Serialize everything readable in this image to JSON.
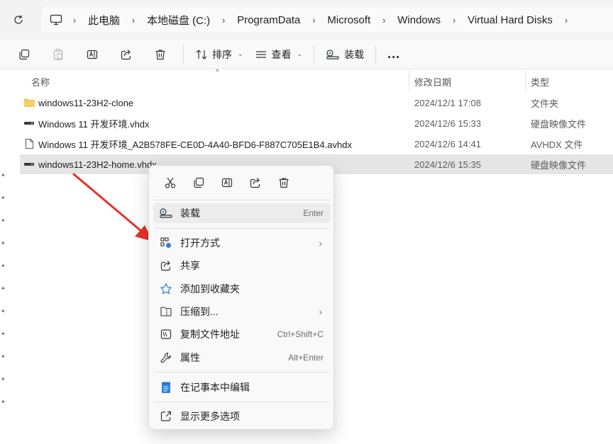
{
  "address_bar": {
    "refresh_icon": "refresh-icon",
    "pc_icon": "computer-icon",
    "crumbs": [
      "此电脑",
      "本地磁盘 (C:)",
      "ProgramData",
      "Microsoft",
      "Windows",
      "Virtual Hard Disks"
    ]
  },
  "toolbar": {
    "sort_label": "排序",
    "view_label": "查看",
    "mount_label": "装载",
    "more_label": "..."
  },
  "columns": {
    "name": "名称",
    "date": "修改日期",
    "type": "类型"
  },
  "files": [
    {
      "name": "windows11-23H2-clone",
      "date": "2024/12/1 17:08",
      "type": "文件夹",
      "icon": "folder-icon"
    },
    {
      "name": "Windows 11 开发环境.vhdx",
      "date": "2024/12/6 15:33",
      "type": "硬盘映像文件",
      "icon": "disk-image-icon"
    },
    {
      "name": "Windows 11 开发环境_A2B578FE-CE0D-4A40-BFD6-F887C705E1B4.avhdx",
      "date": "2024/12/6 14:41",
      "type": "AVHDX 文件",
      "icon": "file-icon"
    },
    {
      "name": "windows11-23H2-home.vhdx",
      "date": "2024/12/6 15:35",
      "type": "硬盘映像文件",
      "icon": "disk-image-icon",
      "selected": true
    }
  ],
  "context_menu": {
    "quick_actions": [
      "cut-icon",
      "copy-icon",
      "rename-icon",
      "share-icon",
      "delete-icon"
    ],
    "items": [
      {
        "label": "装载",
        "shortcut": "Enter",
        "icon": "mount-icon"
      },
      {
        "label": "打开方式",
        "icon": "open-with-icon",
        "submenu": true
      },
      {
        "label": "共享",
        "icon": "share-icon"
      },
      {
        "label": "添加到收藏夹",
        "icon": "star-icon"
      },
      {
        "label": "压缩到...",
        "icon": "zip-icon",
        "submenu": true
      },
      {
        "label": "复制文件地址",
        "shortcut": "Ctrl+Shift+C",
        "icon": "copy-path-icon"
      },
      {
        "label": "属性",
        "shortcut": "Alt+Enter",
        "icon": "wrench-icon"
      },
      {
        "label": "在记事本中编辑",
        "icon": "notepad-icon"
      },
      {
        "label": "显示更多选项",
        "icon": "more-options-icon"
      }
    ]
  },
  "colors": {
    "accent_red": "#e8302a",
    "selection": "#e5e5e5",
    "folder": "#f2c14e",
    "notepad_blue": "#2f7fd6"
  }
}
